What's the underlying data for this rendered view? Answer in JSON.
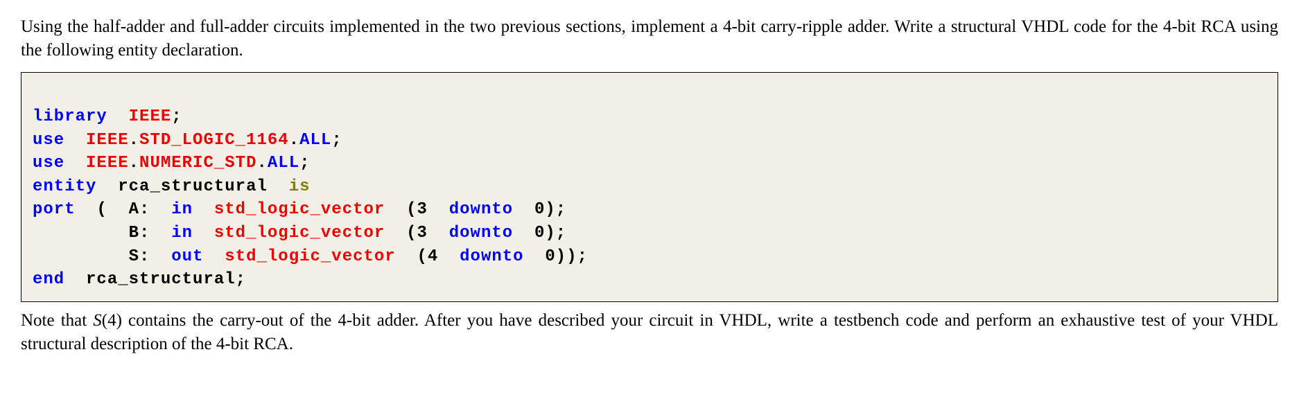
{
  "intro_text": "Using the half-adder and full-adder circuits implemented in the two previous sections, implement a 4-bit carry-ripple adder.  Write a structural VHDL code for the 4-bit RCA using the following entity declaration.",
  "code": {
    "line1": {
      "kw1": "library",
      "kw2": "IEEE",
      "rest": ";"
    },
    "line2": {
      "kw1": "use",
      "red1": "IEEE",
      "dot1": ".",
      "red2": "STD_LOGIC_1164",
      "dot2": ".",
      "kw2": "ALL",
      "rest": ";"
    },
    "line3": {
      "kw1": "use",
      "red1": "IEEE",
      "dot1": ".",
      "red2": "NUMERIC_STD",
      "dot2": ".",
      "kw2": "ALL",
      "rest": ";"
    },
    "line4": {
      "kw1": "entity",
      "name": "rca_structural",
      "kw2": "is"
    },
    "line5": {
      "kw1": "port",
      "paren": "(  A:",
      "kw2": "in",
      "red1": "std_logic_vector",
      "rest1": "(3",
      "kw3": "downto",
      "rest2": "0);"
    },
    "line6": {
      "indent": "         B:",
      "kw1": "in",
      "red1": "std_logic_vector",
      "rest1": "(3",
      "kw2": "downto",
      "rest2": "0);"
    },
    "line7": {
      "indent": "         S:",
      "kw1": "out",
      "red1": "std_logic_vector",
      "rest1": "(4",
      "kw2": "downto",
      "rest2": "0));"
    },
    "line8": {
      "kw1": "end",
      "name": "rca_structural",
      "rest": ";"
    }
  },
  "outro_before": "Note that ",
  "outro_s": "S",
  "outro_paren": "(4) contains the carry-out of the 4-bit adder.  After you have described your circuit in VHDL, write a testbench code and perform an exhaustive test of your VHDL structural description of the 4-bit RCA."
}
